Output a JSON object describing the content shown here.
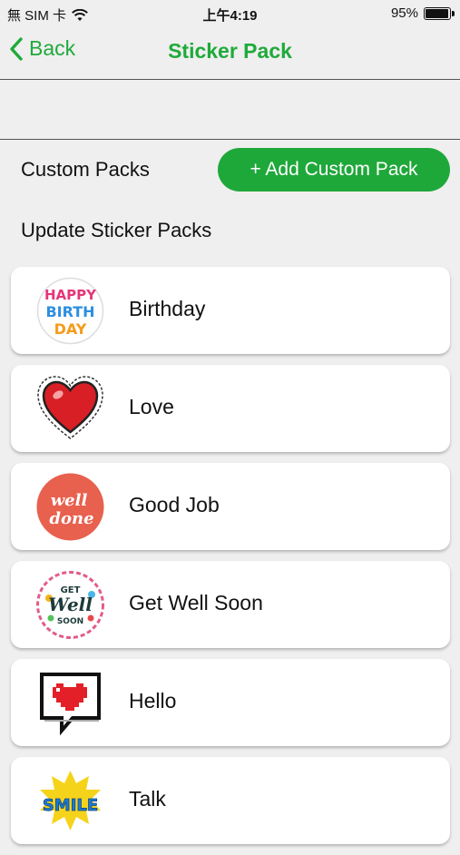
{
  "status": {
    "carrier": "無 SIM 卡",
    "time": "上午4:19",
    "battery": "95%",
    "battery_level": 0.95
  },
  "nav": {
    "back_label": "Back",
    "title": "Sticker Pack"
  },
  "custom": {
    "label": "Custom Packs",
    "add_button": "+ Add Custom Pack"
  },
  "update_label": "Update Sticker Packs",
  "packs": [
    {
      "label": "Birthday",
      "icon": "birthday-sticker-icon"
    },
    {
      "label": "Love",
      "icon": "heart-sticker-icon"
    },
    {
      "label": "Good Job",
      "icon": "well-done-sticker-icon"
    },
    {
      "label": "Get Well Soon",
      "icon": "get-well-sticker-icon"
    },
    {
      "label": "Hello",
      "icon": "pixel-heart-bubble-icon"
    },
    {
      "label": "Talk",
      "icon": "smile-sticker-icon"
    }
  ],
  "colors": {
    "accent": "#1faa3b",
    "button": "#1fa83a",
    "background": "#efefef"
  }
}
